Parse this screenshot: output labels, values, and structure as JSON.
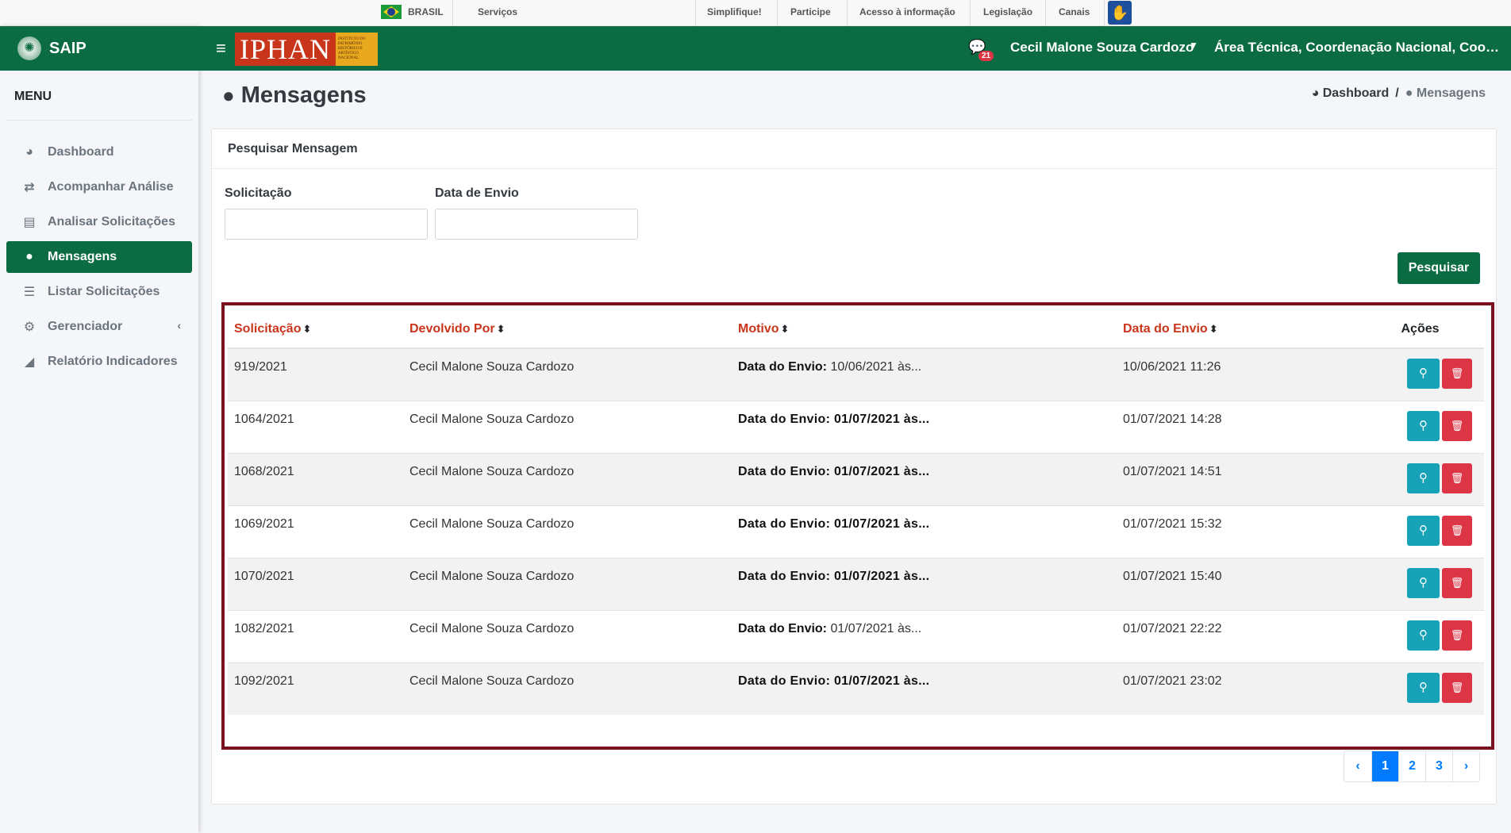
{
  "govbar": {
    "brasil": "BRASIL",
    "servicos": "Serviços",
    "links": [
      "Simplifique!",
      "Participe",
      "Acesso à informação",
      "Legislação",
      "Canais"
    ]
  },
  "app": {
    "name": "SAIP",
    "logo_word": "IPHAN",
    "logo_small": "INSTITUTO DO PATRIMÔNIO HISTÓRICO E ARTÍSTICO NACIONAL"
  },
  "topnav": {
    "message_count": "21",
    "user_name": "Cecil Malone Souza Cardozo",
    "user_area": "Área Técnica, Coordenação Nacional, Coor..."
  },
  "sidebar": {
    "title": "MENU",
    "items": [
      {
        "label": "Dashboard",
        "icon": "dashboard-icon"
      },
      {
        "label": "Acompanhar Análise",
        "icon": "exchange-icon"
      },
      {
        "label": "Analisar Solicitações",
        "icon": "book-icon"
      },
      {
        "label": "Mensagens",
        "icon": "comments-icon",
        "active": true
      },
      {
        "label": "Listar Solicitações",
        "icon": "list-icon"
      },
      {
        "label": "Gerenciador",
        "icon": "cogs-icon"
      },
      {
        "label": "Relatório Indicadores",
        "icon": "area-chart-icon"
      }
    ]
  },
  "page": {
    "title": "Mensagens",
    "breadcrumb": [
      "Dashboard",
      "Mensagens"
    ]
  },
  "search": {
    "card_title": "Pesquisar Mensagem",
    "solicitacao_label": "Solicitação",
    "solicitacao_value": "",
    "data_envio_label": "Data de Envio",
    "data_envio_value": "",
    "button": "Pesquisar"
  },
  "table": {
    "headers": [
      "Solicitação",
      "Devolvido Por",
      "Motivo",
      "Data do Envio",
      "Ações"
    ],
    "rows": [
      {
        "solicitacao": "919/2021",
        "devolvido_por": "Cecil Malone Souza Cardozo",
        "motivo_label": "Data do Envio:",
        "motivo_value": "10/06/2021 às...",
        "motivo_bold": false,
        "data_envio": "10/06/2021 11:26"
      },
      {
        "solicitacao": "1064/2021",
        "devolvido_por": "Cecil Malone Souza Cardozo",
        "motivo_label": "Data do Envio:",
        "motivo_value": "01/07/2021 às...",
        "motivo_bold": true,
        "data_envio": "01/07/2021 14:28"
      },
      {
        "solicitacao": "1068/2021",
        "devolvido_por": "Cecil Malone Souza Cardozo",
        "motivo_label": "Data do Envio:",
        "motivo_value": "01/07/2021 às...",
        "motivo_bold": true,
        "data_envio": "01/07/2021 14:51"
      },
      {
        "solicitacao": "1069/2021",
        "devolvido_por": "Cecil Malone Souza Cardozo",
        "motivo_label": "Data do Envio:",
        "motivo_value": "01/07/2021 às...",
        "motivo_bold": true,
        "data_envio": "01/07/2021 15:32"
      },
      {
        "solicitacao": "1070/2021",
        "devolvido_por": "Cecil Malone Souza Cardozo",
        "motivo_label": "Data do Envio:",
        "motivo_value": "01/07/2021 às...",
        "motivo_bold": true,
        "data_envio": "01/07/2021 15:40"
      },
      {
        "solicitacao": "1082/2021",
        "devolvido_por": "Cecil Malone Souza Cardozo",
        "motivo_label": "Data do Envio:",
        "motivo_value": "01/07/2021 às...",
        "motivo_bold": false,
        "data_envio": "01/07/2021 22:22"
      },
      {
        "solicitacao": "1092/2021",
        "devolvido_por": "Cecil Malone Souza Cardozo",
        "motivo_label": "Data do Envio:",
        "motivo_value": "01/07/2021 às...",
        "motivo_bold": true,
        "data_envio": "01/07/2021 23:02"
      }
    ]
  },
  "pagination": {
    "prev": "‹",
    "pages": [
      "1",
      "2",
      "3"
    ],
    "current": "1",
    "next": "›"
  },
  "colors": {
    "primary_green": "#0b6b43",
    "header_red": "#c8351b",
    "highlight_border": "#7b1020",
    "view_button": "#17a2b8",
    "delete_button": "#dc3545",
    "pagination_active": "#007bff"
  }
}
